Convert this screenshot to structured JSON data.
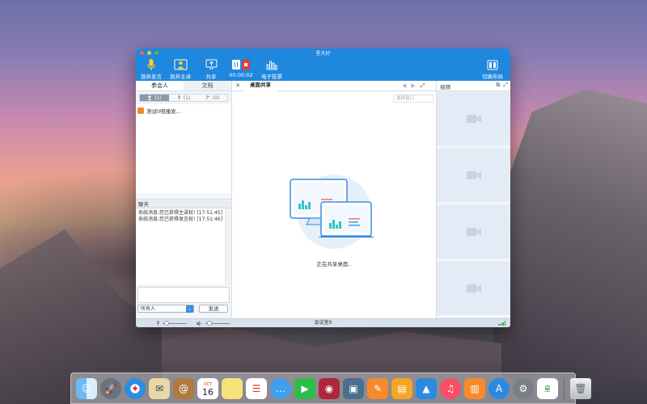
{
  "window": {
    "title": "星天好"
  },
  "toolbar": {
    "buttons": [
      {
        "label": "放弃发言"
      },
      {
        "label": "放弃主讲"
      },
      {
        "label": "共享"
      },
      {
        "label": "00:00:02"
      },
      {
        "label": "电子投票"
      }
    ],
    "layout_label": "切换布局"
  },
  "left": {
    "tabs": [
      "参会人",
      "文档"
    ],
    "filters": [
      "(1)",
      "(1)",
      "(0)"
    ],
    "participants": [
      "测试0咀撞发..."
    ],
    "chat": {
      "title": "聊天",
      "messages": [
        "系统消息:您已获得主讲权! [17:51:45]",
        "系统消息:您已获得发言权! [17:51:46]"
      ],
      "recipient": "所有人",
      "send_label": "发送"
    }
  },
  "center": {
    "tab_label": "桌面共享",
    "window_select_placeholder": "选择窗口",
    "status": "正在共享桌面.."
  },
  "right": {
    "title": "视频"
  },
  "statusbar": {
    "text": "会议室0"
  },
  "colors": {
    "accent": "#1f87de",
    "video_bg": "#e3ebf6"
  },
  "dock": {
    "icons": [
      "finder-icon",
      "launchpad-icon",
      "safari-icon",
      "mail-icon",
      "contacts-icon",
      "calendar-icon",
      "notes-icon",
      "reminders-icon",
      "messages-icon",
      "facetime-icon",
      "photo-booth-icon",
      "iphoto-icon",
      "itunes-icon",
      "ibooks-icon",
      "app-store-icon",
      "system-preferences-icon",
      "custom-app-icon",
      "trash-icon"
    ],
    "calendar_month": "OCT",
    "calendar_day": "16"
  }
}
